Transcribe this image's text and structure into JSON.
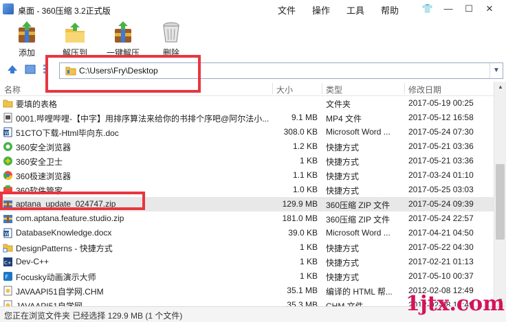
{
  "window": {
    "title": "桌面 - 360压缩 3.2正式版"
  },
  "menu": [
    "文件",
    "操作",
    "工具",
    "帮助"
  ],
  "window_controls": {
    "skin": "👕",
    "minimize": "—",
    "maximize": "☐",
    "close": "✕"
  },
  "toolbar": {
    "add": "添加",
    "extract": "解压到",
    "one_click": "一键解压",
    "delete": "删除"
  },
  "address": {
    "path": "C:\\Users\\Fry\\Desktop"
  },
  "columns": {
    "name": "名称",
    "size": "大小",
    "type": "类型",
    "date": "修改日期"
  },
  "files": [
    {
      "name": "要填的表格",
      "size": "",
      "type": "文件夹",
      "date": "2017-05-19 00:25",
      "icon": "folder-icon"
    },
    {
      "name": "0001.哔哩哔哩-【中字】用排序算法来给你的书排个序吧@阿尔法小...",
      "size": "9.1 MB",
      "type": "MP4 文件",
      "date": "2017-05-12 16:58",
      "icon": "video-file-icon"
    },
    {
      "name": "51CTO下载-Html毕向东.doc",
      "size": "308.0 KB",
      "type": "Microsoft Word ...",
      "date": "2017-05-24 07:30",
      "icon": "word-doc-icon"
    },
    {
      "name": "360安全浏览器",
      "size": "1.2 KB",
      "type": "快捷方式",
      "date": "2017-05-21 03:36",
      "icon": "browser-360-icon"
    },
    {
      "name": "360安全卫士",
      "size": "1 KB",
      "type": "快捷方式",
      "date": "2017-05-21 03:36",
      "icon": "security-360-icon"
    },
    {
      "name": "360极速浏览器",
      "size": "1.1 KB",
      "type": "快捷方式",
      "date": "2017-03-24 01:10",
      "icon": "chrome-360-icon"
    },
    {
      "name": "360软件管家",
      "size": "1.0 KB",
      "type": "快捷方式",
      "date": "2017-05-25 03:03",
      "icon": "software-manager-icon"
    },
    {
      "name": "aptana_update_024747.zip",
      "size": "129.9 MB",
      "type": "360压缩 ZIP 文件",
      "date": "2017-05-24 09:39",
      "icon": "zip-archive-icon"
    },
    {
      "name": "com.aptana.feature.studio.zip",
      "size": "181.0 MB",
      "type": "360压缩 ZIP 文件",
      "date": "2017-05-24 22:57",
      "icon": "zip-archive-icon"
    },
    {
      "name": "DatabaseKnowledge.docx",
      "size": "39.0 KB",
      "type": "Microsoft Word ...",
      "date": "2017-04-21 04:50",
      "icon": "word-doc-icon"
    },
    {
      "name": "DesignPatterns - 快捷方式",
      "size": "1 KB",
      "type": "快捷方式",
      "date": "2017-05-22 04:30",
      "icon": "folder-shortcut-icon"
    },
    {
      "name": "Dev-C++",
      "size": "1 KB",
      "type": "快捷方式",
      "date": "2017-02-21 01:13",
      "icon": "devcpp-icon"
    },
    {
      "name": "Focusky动画演示大师",
      "size": "1 KB",
      "type": "快捷方式",
      "date": "2017-05-10 00:37",
      "icon": "focusky-icon"
    },
    {
      "name": "JAVAAPI51自学网.CHM",
      "size": "35.1 MB",
      "type": "编译的 HTML 帮...",
      "date": "2012-02-08 12:49",
      "icon": "chm-file-icon"
    },
    {
      "name": "JAVAAPI51自学网...",
      "size": "35.3 MB",
      "type": "CHM 文件",
      "date": "2012-02-08 12:49",
      "icon": "chm-file-icon"
    }
  ],
  "selected_index": 7,
  "status": {
    "text": "您正在浏览文件夹   已经选择 129.9 MB (1 个文件)"
  },
  "watermark": "1jtx.com",
  "colors": {
    "highlight_box": "#e8363f",
    "selected_row": "#e8e8e8",
    "watermark": "#d4145a"
  }
}
